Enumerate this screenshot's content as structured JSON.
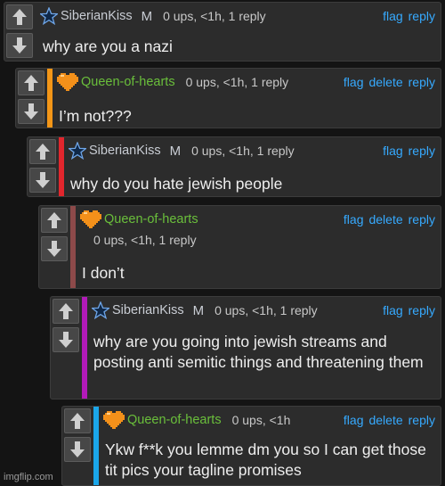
{
  "comments": [
    {
      "user": "SiberianKiss",
      "badge": "M",
      "meta": "0 ups, <1h, 1 reply",
      "actions": [
        "flag",
        "reply"
      ],
      "text": "why are you a nazi",
      "accent": "",
      "avatar": "blue-star-icon"
    },
    {
      "user": "Queen-of-hearts",
      "meta": "0 ups, <1h, 1 reply",
      "actions": [
        "flag",
        "delete",
        "reply"
      ],
      "text": "I’m not???",
      "accent": "#f39617",
      "avatar": "orange-heart-icon"
    },
    {
      "user": "SiberianKiss",
      "badge": "M",
      "meta": "0 ups, <1h, 1 reply",
      "actions": [
        "flag",
        "reply"
      ],
      "text": "why do you hate jewish people",
      "accent": "#e2262d",
      "avatar": "blue-star-icon"
    },
    {
      "user": "Queen-of-hearts",
      "meta": "0 ups, <1h, 1 reply",
      "actions": [
        "flag",
        "delete",
        "reply"
      ],
      "text": "I don’t",
      "accent": "#8d4a4a",
      "avatar": "orange-heart-icon"
    },
    {
      "user": "SiberianKiss",
      "badge": "M",
      "meta": "0 ups, <1h, 1 reply",
      "actions": [
        "flag",
        "reply"
      ],
      "text": "why are you going into jewish streams and posting anti semitic things and threatening them",
      "accent": "#b21ab9",
      "avatar": "blue-star-icon"
    },
    {
      "user": "Queen-of-hearts",
      "meta": "0 ups, <1h",
      "actions": [
        "flag",
        "delete",
        "reply"
      ],
      "text": "Ykw f**k you lemme dm you so I can get those tit pics your tagline promises",
      "accent": "#1aa6ea",
      "avatar": "orange-heart-icon"
    }
  ],
  "watermark": "imgflip.com",
  "colors": {
    "link": "#36aaff",
    "page_bg": "#141414",
    "card_bg": "#2c2c2c",
    "queen_name": "#6abf3b"
  }
}
